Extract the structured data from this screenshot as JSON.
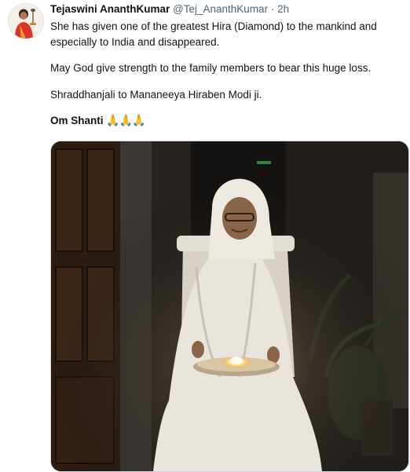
{
  "author": {
    "display_name": "Tejaswini AnanthKumar",
    "handle": "@Tej_AnanthKumar",
    "separator": "·",
    "time": "2h"
  },
  "tweet": {
    "line1": "She has given one of the greatest Hira (Diamond) to the mankind and",
    "line2": "especially to India and disappeared.",
    "para2": "May God give strength to the family members to bear this huge loss.",
    "para3": "Shraddhanjali to Mananeeya Hiraben Modi ji.",
    "om": "Om Shanti",
    "emoji": "🙏🙏🙏"
  },
  "colors": {
    "text_primary": "#0f1419",
    "text_secondary": "#536471",
    "photo_background": "#1b1815"
  },
  "icons": {
    "avatar": "profile-photo",
    "prayer": "folded-hands-emoji"
  }
}
